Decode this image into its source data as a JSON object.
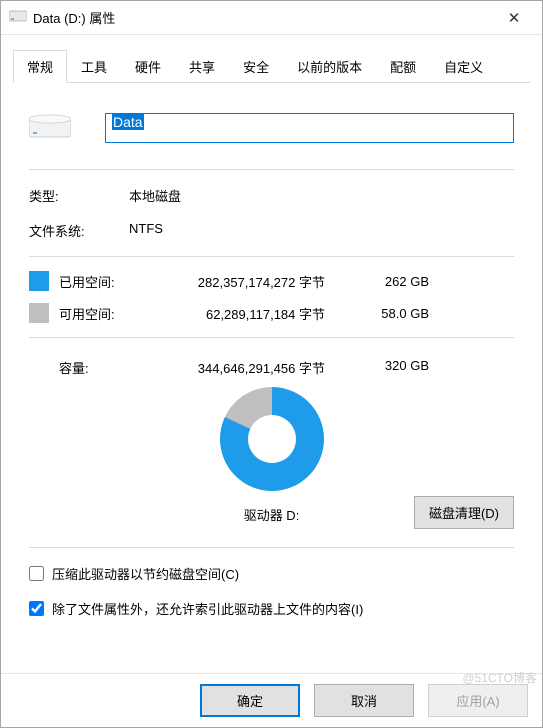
{
  "window": {
    "title": "Data (D:) 属性"
  },
  "tabs": [
    "常规",
    "工具",
    "硬件",
    "共享",
    "安全",
    "以前的版本",
    "配额",
    "自定义"
  ],
  "active_tab": 0,
  "drive_name": "Data",
  "type": {
    "label": "类型:",
    "value": "本地磁盘"
  },
  "filesystem": {
    "label": "文件系统:",
    "value": "NTFS"
  },
  "used": {
    "label": "已用空间:",
    "bytes": "282,357,174,272 字节",
    "gb": "262 GB",
    "color": "#1e9be9"
  },
  "free": {
    "label": "可用空间:",
    "bytes": "62,289,117,184 字节",
    "gb": "58.0 GB",
    "color": "#bfbfbf"
  },
  "capacity": {
    "label": "容量:",
    "bytes": "344,646,291,456 字节",
    "gb": "320 GB"
  },
  "drive_letter_label": "驱动器 D:",
  "cleanup_button": "磁盘清理(D)",
  "compress": {
    "label": "压缩此驱动器以节约磁盘空间(C)",
    "checked": false
  },
  "index": {
    "label": "除了文件属性外，还允许索引此驱动器上文件的内容(I)",
    "checked": true
  },
  "buttons": {
    "ok": "确定",
    "cancel": "取消",
    "apply": "应用(A)"
  },
  "watermark": "@51CTO博客",
  "chart_data": {
    "type": "pie",
    "title": "驱动器 D:",
    "series": [
      {
        "name": "已用空间",
        "value": 282357174272,
        "color": "#1e9be9"
      },
      {
        "name": "可用空间",
        "value": 62289117184,
        "color": "#bfbfbf"
      }
    ]
  }
}
